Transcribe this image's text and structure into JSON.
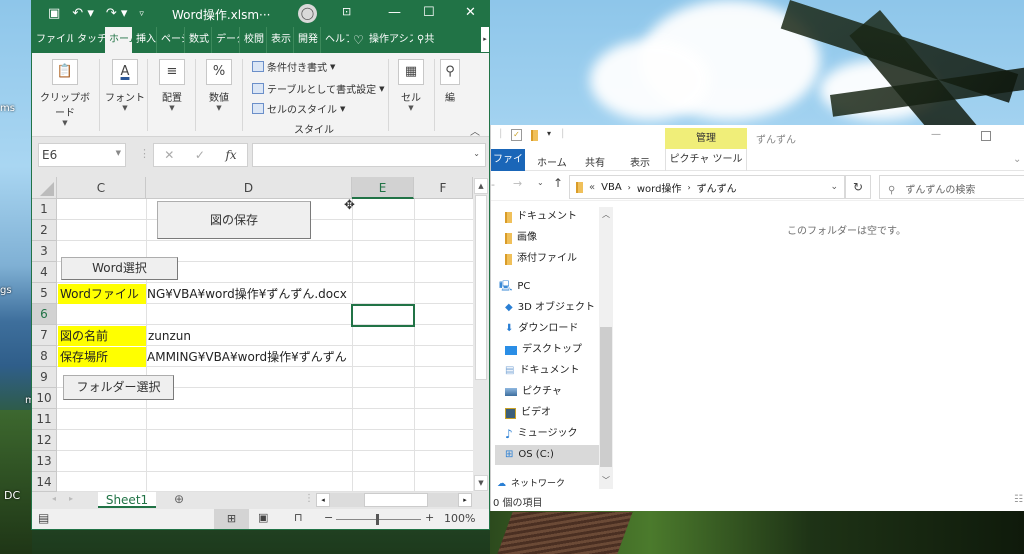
{
  "desktop": {
    "labels": [
      "ms",
      "gs",
      "m",
      "DC"
    ]
  },
  "excel": {
    "title": "Word操作.xlsm···",
    "quick_access": {
      "save_icon": "save-icon",
      "undo_icon": "undo-icon",
      "redo_icon": "redo-icon",
      "customize_icon": "customize-icon"
    },
    "window_buttons": {
      "ribbon_display": "⊡",
      "minimize": "—",
      "maximize": "☐",
      "close": "✕"
    },
    "tabs": [
      {
        "label": "ファイル",
        "active": false
      },
      {
        "label": "タッチ",
        "active": false
      },
      {
        "label": "ホーム",
        "active": true
      },
      {
        "label": "挿入",
        "active": false
      },
      {
        "label": "ページ",
        "active": false
      },
      {
        "label": "数式",
        "active": false
      },
      {
        "label": "データ",
        "active": false
      },
      {
        "label": "校閲",
        "active": false
      },
      {
        "label": "表示",
        "active": false
      },
      {
        "label": "開発",
        "active": false
      },
      {
        "label": "ヘルプ",
        "active": false
      }
    ],
    "tell_me": "操作アシスト",
    "share": "共",
    "ribbon": {
      "clipboard": "クリップボード",
      "font": "フォント",
      "alignment": "配置",
      "number": "数値",
      "conditional_format": "条件付き書式",
      "format_as_table": "テーブルとして書式設定",
      "cell_styles": "セルのスタイル",
      "styles_group": "スタイル",
      "cells": "セル",
      "editing": "編"
    },
    "name_box": "E6",
    "formula": "",
    "columns": [
      {
        "label": "C",
        "selected": false
      },
      {
        "label": "D",
        "selected": false
      },
      {
        "label": "E",
        "selected": true
      },
      {
        "label": "F",
        "selected": false
      }
    ],
    "rows": [
      "1",
      "2",
      "3",
      "4",
      "5",
      "6",
      "7",
      "8",
      "9",
      "10",
      "11",
      "12",
      "13",
      "14"
    ],
    "selected_row": "6",
    "cells": {
      "c5": "Wordファイル",
      "d5": "NG¥VBA¥word操作¥ずんずん.docx",
      "c7": "図の名前",
      "d7": "zunzun",
      "c8": "保存場所",
      "d8": "AMMING¥VBA¥word操作¥ずんずん"
    },
    "buttons": {
      "save_figure": "図の保存",
      "select_word": "Word選択",
      "select_folder": "フォルダー選択"
    },
    "sheet_tab": "Sheet1",
    "zoom": "100%"
  },
  "explorer": {
    "title": "ずんずん",
    "context_tab_header": "管理",
    "context_tab": "ピクチャ ツール",
    "tabs": [
      "ファイル",
      "ホーム",
      "共有",
      "表示"
    ],
    "breadcrumb": [
      "«",
      "VBA",
      "word操作",
      "ずんずん"
    ],
    "search_placeholder": "ずんずんの検索",
    "nav_items": [
      {
        "label": "ドキュメント",
        "icon": "folder-icon"
      },
      {
        "label": "画像",
        "icon": "folder-icon"
      },
      {
        "label": "添付ファイル",
        "icon": "folder-icon"
      },
      {
        "label": "PC",
        "icon": "pc-icon"
      },
      {
        "label": "3D オブジェクト",
        "icon": "3d-objects-icon"
      },
      {
        "label": "ダウンロード",
        "icon": "download-icon"
      },
      {
        "label": "デスクトップ",
        "icon": "desktop-icon"
      },
      {
        "label": "ドキュメント",
        "icon": "documents-icon"
      },
      {
        "label": "ピクチャ",
        "icon": "pictures-icon"
      },
      {
        "label": "ビデオ",
        "icon": "videos-icon"
      },
      {
        "label": "ミュージック",
        "icon": "music-icon"
      },
      {
        "label": "OS (C:)",
        "icon": "drive-icon",
        "selected": true
      },
      {
        "label": "ネットワーク",
        "icon": "network-icon"
      }
    ],
    "empty_message": "このフォルダーは空です。",
    "status": "0 個の項目"
  }
}
